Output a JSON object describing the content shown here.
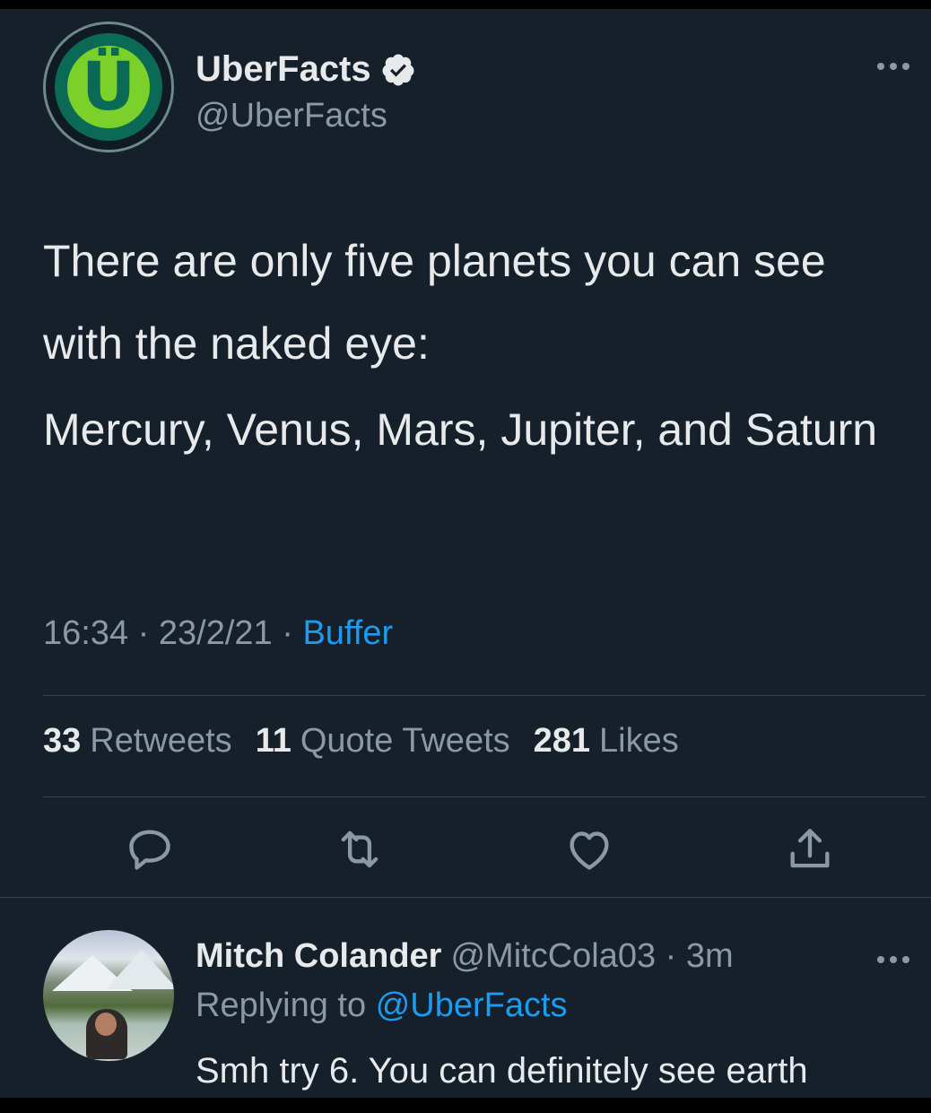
{
  "tweet": {
    "author": {
      "name": "UberFacts",
      "handle": "@UberFacts",
      "avatar_letter": "Ü",
      "verified": true
    },
    "paragraphs": [
      "There are only five planets you can see with the naked eye:",
      "Mercury, Venus, Mars, Jupiter, and Saturn"
    ],
    "meta": {
      "time": "16:34",
      "separator": " · ",
      "date": "23/2/21",
      "source": "Buffer"
    },
    "stats": {
      "retweets_count": "33",
      "retweets_label": "Retweets",
      "quotes_count": "11",
      "quotes_label": "Quote Tweets",
      "likes_count": "281",
      "likes_label": "Likes"
    },
    "actions": [
      "reply-icon",
      "retweet-icon",
      "like-icon",
      "share-icon"
    ]
  },
  "reply": {
    "name": "Mitch Colander",
    "handle": "@MitcCola03",
    "separator": " · ",
    "time": "3m",
    "replying_prefix": "Replying to",
    "replying_to": "@UberFacts",
    "text": "Smh try 6. You can definitely see earth"
  },
  "colors": {
    "background": "#15202b",
    "text": "#e7e9ea",
    "secondary": "#8b98a5",
    "accent": "#1d9bf0",
    "divider": "#38444d"
  }
}
